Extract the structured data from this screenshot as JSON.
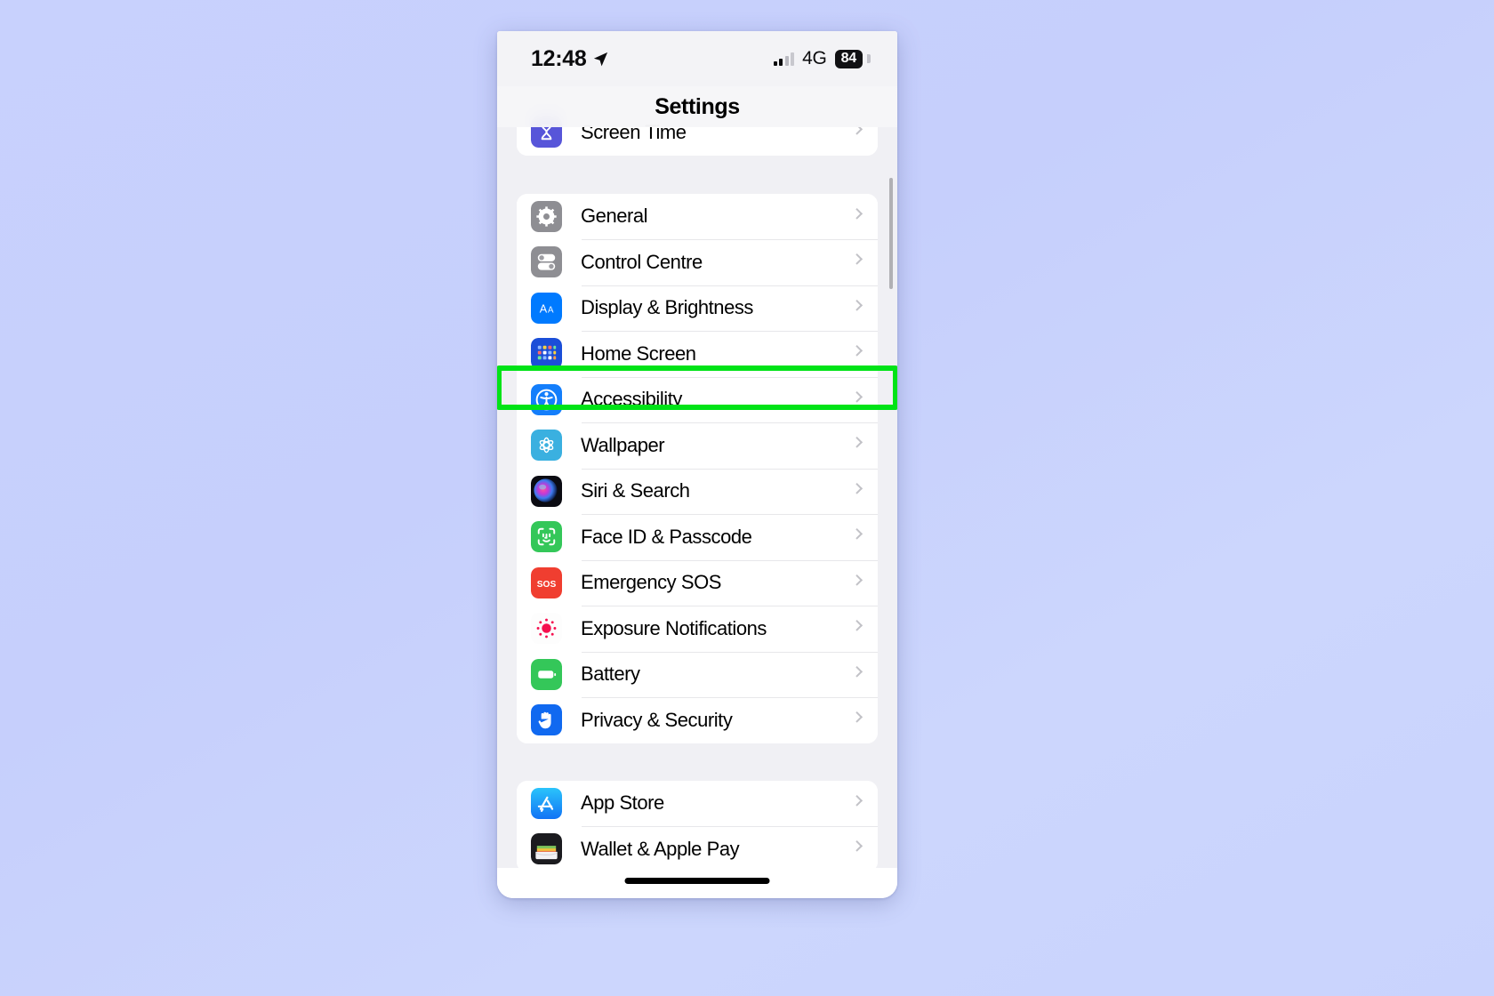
{
  "status_bar": {
    "time": "12:48",
    "location_icon": "location-arrow-icon",
    "signal_icon": "cellular-bars-icon",
    "network": "4G",
    "battery_percent": "84"
  },
  "nav": {
    "title": "Settings"
  },
  "groups": [
    {
      "name": "clipped-group",
      "rows": [
        {
          "label": "Screen Time",
          "icon": "screen-time-icon"
        }
      ]
    },
    {
      "name": "system-group",
      "rows": [
        {
          "label": "General",
          "icon": "gear-icon"
        },
        {
          "label": "Control Centre",
          "icon": "control-centre-icon"
        },
        {
          "label": "Display & Brightness",
          "icon": "display-brightness-icon"
        },
        {
          "label": "Home Screen",
          "icon": "home-screen-icon"
        },
        {
          "label": "Accessibility",
          "icon": "accessibility-icon"
        },
        {
          "label": "Wallpaper",
          "icon": "wallpaper-icon"
        },
        {
          "label": "Siri & Search",
          "icon": "siri-icon"
        },
        {
          "label": "Face ID & Passcode",
          "icon": "face-id-icon"
        },
        {
          "label": "Emergency SOS",
          "icon": "sos-icon"
        },
        {
          "label": "Exposure Notifications",
          "icon": "exposure-notifications-icon"
        },
        {
          "label": "Battery",
          "icon": "battery-icon"
        },
        {
          "label": "Privacy & Security",
          "icon": "privacy-hand-icon"
        }
      ]
    },
    {
      "name": "store-group",
      "rows": [
        {
          "label": "App Store",
          "icon": "app-store-icon"
        },
        {
          "label": "Wallet & Apple Pay",
          "icon": "wallet-icon"
        }
      ]
    }
  ],
  "highlight": {
    "target_label": "Accessibility",
    "color": "#00e317"
  },
  "colors": {
    "page_background": "#c8d1fd",
    "list_background": "#f0f0f4",
    "row_background": "#ffffff",
    "separator": "#e7e7ea",
    "chevron": "#c2c2c7",
    "label_text": "#000000"
  }
}
